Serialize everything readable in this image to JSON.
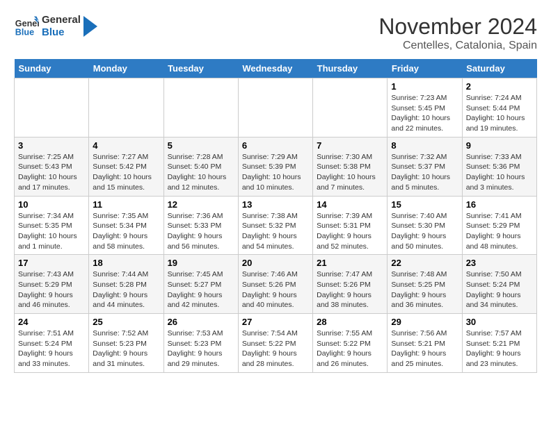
{
  "logo": {
    "line1": "General",
    "line2": "Blue"
  },
  "title": {
    "month_year": "November 2024",
    "location": "Centelles, Catalonia, Spain"
  },
  "weekdays": [
    "Sunday",
    "Monday",
    "Tuesday",
    "Wednesday",
    "Thursday",
    "Friday",
    "Saturday"
  ],
  "weeks": [
    [
      {
        "day": "",
        "info": ""
      },
      {
        "day": "",
        "info": ""
      },
      {
        "day": "",
        "info": ""
      },
      {
        "day": "",
        "info": ""
      },
      {
        "day": "",
        "info": ""
      },
      {
        "day": "1",
        "info": "Sunrise: 7:23 AM\nSunset: 5:45 PM\nDaylight: 10 hours\nand 22 minutes."
      },
      {
        "day": "2",
        "info": "Sunrise: 7:24 AM\nSunset: 5:44 PM\nDaylight: 10 hours\nand 19 minutes."
      }
    ],
    [
      {
        "day": "3",
        "info": "Sunrise: 7:25 AM\nSunset: 5:43 PM\nDaylight: 10 hours\nand 17 minutes."
      },
      {
        "day": "4",
        "info": "Sunrise: 7:27 AM\nSunset: 5:42 PM\nDaylight: 10 hours\nand 15 minutes."
      },
      {
        "day": "5",
        "info": "Sunrise: 7:28 AM\nSunset: 5:40 PM\nDaylight: 10 hours\nand 12 minutes."
      },
      {
        "day": "6",
        "info": "Sunrise: 7:29 AM\nSunset: 5:39 PM\nDaylight: 10 hours\nand 10 minutes."
      },
      {
        "day": "7",
        "info": "Sunrise: 7:30 AM\nSunset: 5:38 PM\nDaylight: 10 hours\nand 7 minutes."
      },
      {
        "day": "8",
        "info": "Sunrise: 7:32 AM\nSunset: 5:37 PM\nDaylight: 10 hours\nand 5 minutes."
      },
      {
        "day": "9",
        "info": "Sunrise: 7:33 AM\nSunset: 5:36 PM\nDaylight: 10 hours\nand 3 minutes."
      }
    ],
    [
      {
        "day": "10",
        "info": "Sunrise: 7:34 AM\nSunset: 5:35 PM\nDaylight: 10 hours\nand 1 minute."
      },
      {
        "day": "11",
        "info": "Sunrise: 7:35 AM\nSunset: 5:34 PM\nDaylight: 9 hours\nand 58 minutes."
      },
      {
        "day": "12",
        "info": "Sunrise: 7:36 AM\nSunset: 5:33 PM\nDaylight: 9 hours\nand 56 minutes."
      },
      {
        "day": "13",
        "info": "Sunrise: 7:38 AM\nSunset: 5:32 PM\nDaylight: 9 hours\nand 54 minutes."
      },
      {
        "day": "14",
        "info": "Sunrise: 7:39 AM\nSunset: 5:31 PM\nDaylight: 9 hours\nand 52 minutes."
      },
      {
        "day": "15",
        "info": "Sunrise: 7:40 AM\nSunset: 5:30 PM\nDaylight: 9 hours\nand 50 minutes."
      },
      {
        "day": "16",
        "info": "Sunrise: 7:41 AM\nSunset: 5:29 PM\nDaylight: 9 hours\nand 48 minutes."
      }
    ],
    [
      {
        "day": "17",
        "info": "Sunrise: 7:43 AM\nSunset: 5:29 PM\nDaylight: 9 hours\nand 46 minutes."
      },
      {
        "day": "18",
        "info": "Sunrise: 7:44 AM\nSunset: 5:28 PM\nDaylight: 9 hours\nand 44 minutes."
      },
      {
        "day": "19",
        "info": "Sunrise: 7:45 AM\nSunset: 5:27 PM\nDaylight: 9 hours\nand 42 minutes."
      },
      {
        "day": "20",
        "info": "Sunrise: 7:46 AM\nSunset: 5:26 PM\nDaylight: 9 hours\nand 40 minutes."
      },
      {
        "day": "21",
        "info": "Sunrise: 7:47 AM\nSunset: 5:26 PM\nDaylight: 9 hours\nand 38 minutes."
      },
      {
        "day": "22",
        "info": "Sunrise: 7:48 AM\nSunset: 5:25 PM\nDaylight: 9 hours\nand 36 minutes."
      },
      {
        "day": "23",
        "info": "Sunrise: 7:50 AM\nSunset: 5:24 PM\nDaylight: 9 hours\nand 34 minutes."
      }
    ],
    [
      {
        "day": "24",
        "info": "Sunrise: 7:51 AM\nSunset: 5:24 PM\nDaylight: 9 hours\nand 33 minutes."
      },
      {
        "day": "25",
        "info": "Sunrise: 7:52 AM\nSunset: 5:23 PM\nDaylight: 9 hours\nand 31 minutes."
      },
      {
        "day": "26",
        "info": "Sunrise: 7:53 AM\nSunset: 5:23 PM\nDaylight: 9 hours\nand 29 minutes."
      },
      {
        "day": "27",
        "info": "Sunrise: 7:54 AM\nSunset: 5:22 PM\nDaylight: 9 hours\nand 28 minutes."
      },
      {
        "day": "28",
        "info": "Sunrise: 7:55 AM\nSunset: 5:22 PM\nDaylight: 9 hours\nand 26 minutes."
      },
      {
        "day": "29",
        "info": "Sunrise: 7:56 AM\nSunset: 5:21 PM\nDaylight: 9 hours\nand 25 minutes."
      },
      {
        "day": "30",
        "info": "Sunrise: 7:57 AM\nSunset: 5:21 PM\nDaylight: 9 hours\nand 23 minutes."
      }
    ]
  ]
}
